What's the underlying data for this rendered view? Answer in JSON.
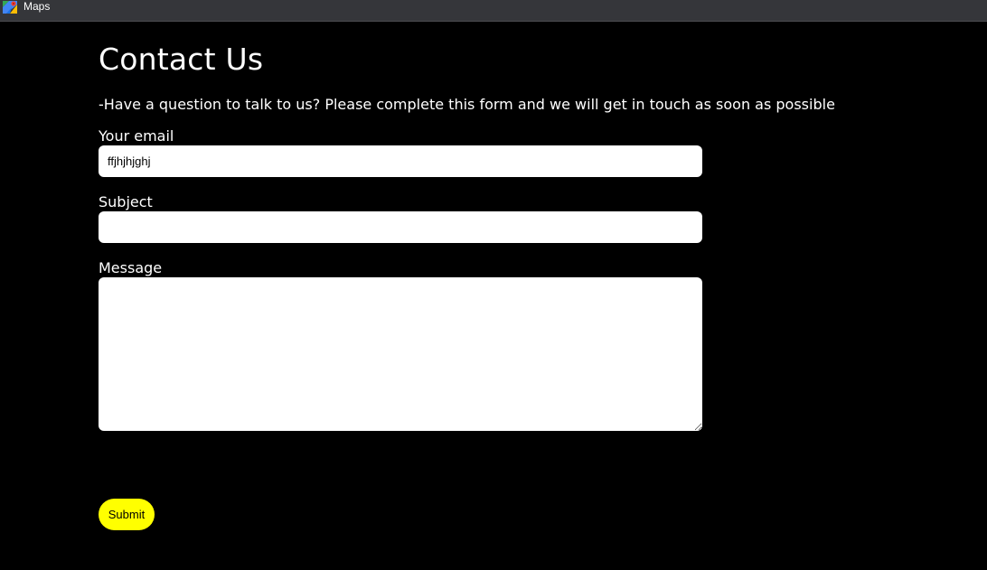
{
  "window": {
    "title": "Maps",
    "icon": "maps-app-icon"
  },
  "page": {
    "title": "Contact Us",
    "intro": "-Have a question to talk to us? Please complete this form and we will get in touch as soon as possible"
  },
  "form": {
    "email": {
      "label": "Your email",
      "value": "ffjhjhjghj",
      "placeholder": ""
    },
    "subject": {
      "label": "Subject",
      "value": "",
      "placeholder": ""
    },
    "message": {
      "label": "Message",
      "value": "",
      "placeholder": ""
    },
    "submit_label": "Submit"
  },
  "colors": {
    "background": "#000000",
    "titlebar": "#35363a",
    "accent": "#ffff00",
    "text": "#ffffff",
    "field": "#ffffff"
  }
}
